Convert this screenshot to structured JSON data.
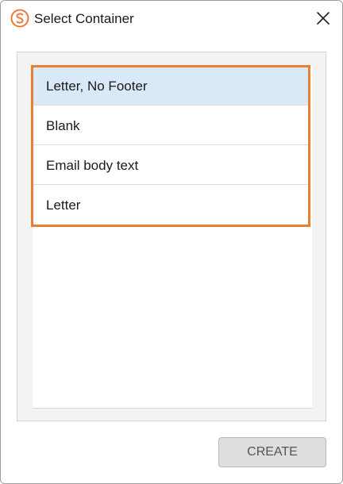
{
  "window": {
    "title": "Select Container",
    "logo_icon": "sugar-logo-icon",
    "close_icon": "close-icon"
  },
  "containers": {
    "items": [
      {
        "label": "Letter, No Footer",
        "selected": true
      },
      {
        "label": "Blank",
        "selected": false
      },
      {
        "label": "Email body text",
        "selected": false
      },
      {
        "label": "Letter",
        "selected": false
      }
    ]
  },
  "footer": {
    "create_label": "CREATE"
  },
  "colors": {
    "highlight": "#ed7d31",
    "selected_row": "#d9e9f7",
    "logo": "#f0793a"
  }
}
